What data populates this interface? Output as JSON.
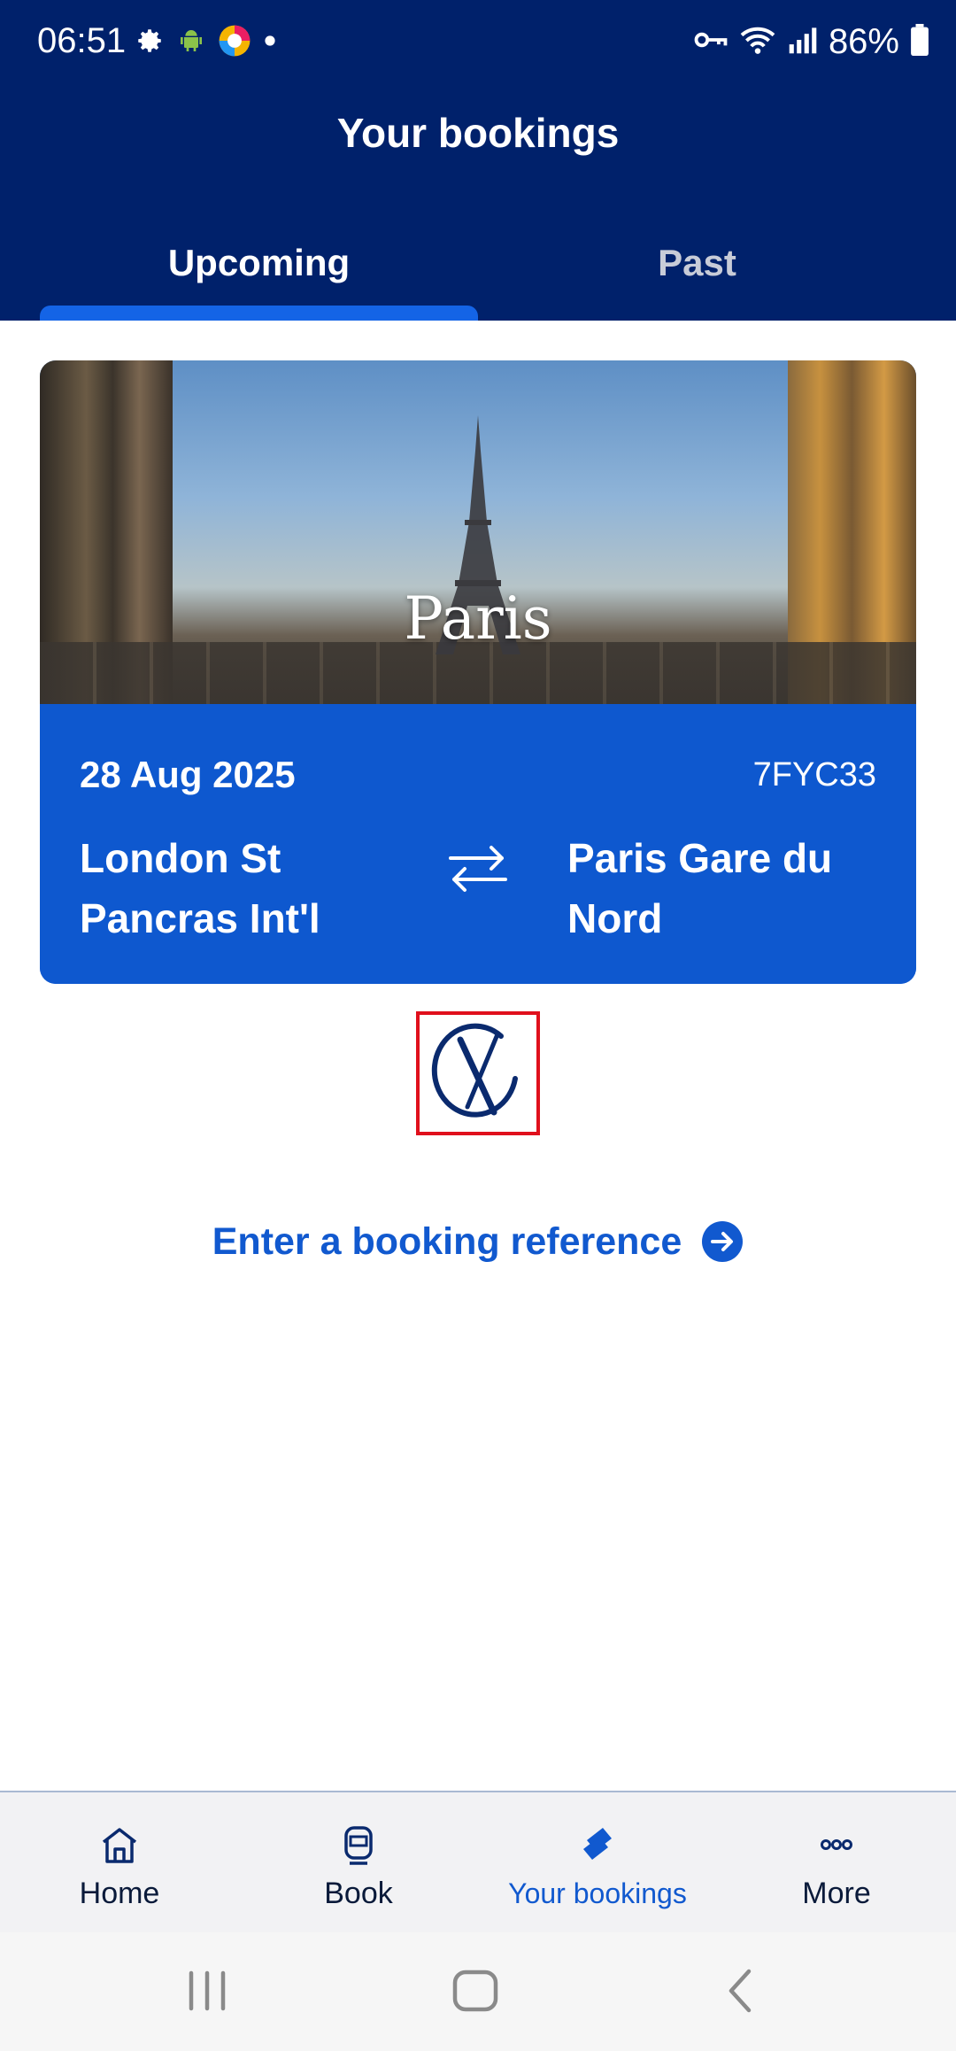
{
  "status_bar": {
    "time": "06:51",
    "battery": "86%",
    "icons_left": [
      "gear-icon",
      "android-icon",
      "app-icon",
      "dot-icon"
    ],
    "icons_right": [
      "key-icon",
      "wifi-icon",
      "signal-icon",
      "battery-icon"
    ]
  },
  "header": {
    "title": "Your bookings"
  },
  "tabs": [
    {
      "label": "Upcoming",
      "active": true
    },
    {
      "label": "Past",
      "active": false
    }
  ],
  "booking": {
    "destination_image_label": "Paris",
    "date": "28 Aug 2025",
    "reference": "7FYC33",
    "origin": "London St Pancras Int'l",
    "destination": "Paris Gare du Nord"
  },
  "enter_reference": {
    "label": "Enter a booking reference"
  },
  "bottom_nav": {
    "items": [
      {
        "label": "Home",
        "icon": "home-icon",
        "active": false
      },
      {
        "label": "Book",
        "icon": "train-icon",
        "active": false
      },
      {
        "label": "Your bookings",
        "icon": "ticket-icon",
        "active": true
      },
      {
        "label": "More",
        "icon": "more-icon",
        "active": false
      }
    ]
  },
  "colors": {
    "header_bg": "#00216b",
    "accent": "#1464e6",
    "card_bg": "#0e58cf",
    "link": "#1159cf"
  }
}
